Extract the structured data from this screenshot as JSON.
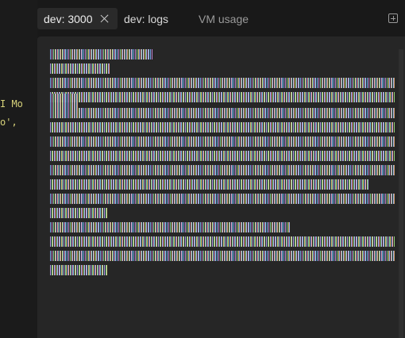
{
  "editor": {
    "lines": [
      "I Mo",
      "o',"
    ]
  },
  "tabs": [
    {
      "label": "dev: 3000",
      "active": true,
      "closable": true
    },
    {
      "label": "dev: logs",
      "active": false
    },
    {
      "label": "VM usage",
      "active": false
    }
  ],
  "icons": {
    "close": "close-icon",
    "add": "add-tab-icon"
  },
  "colors": {
    "background": "#191919",
    "terminal": "#262626",
    "code_text": "#d7d27a"
  }
}
